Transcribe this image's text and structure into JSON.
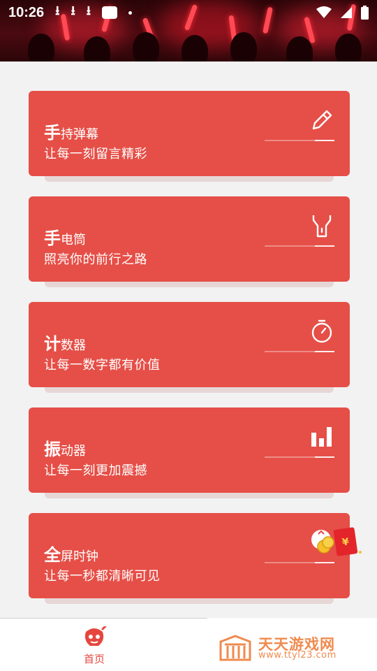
{
  "status_bar": {
    "time": "10:26"
  },
  "cards": [
    {
      "title_big": "手",
      "title_rest": "持弹幕",
      "subtitle": "让每一刻留言精彩",
      "icon": "pencil-icon"
    },
    {
      "title_big": "手",
      "title_rest": "电筒",
      "subtitle": "照亮你的前行之路",
      "icon": "flashlight-icon"
    },
    {
      "title_big": "计",
      "title_rest": "数器",
      "subtitle": "让每一数字都有价值",
      "icon": "stopwatch-icon"
    },
    {
      "title_big": "振",
      "title_rest": "动器",
      "subtitle": "让每一刻更加震撼",
      "icon": "bar-chart-icon"
    },
    {
      "title_big": "全",
      "title_rest": "屏时钟",
      "subtitle": "让每一秒都清晰可见",
      "icon": "red-envelope-icon"
    }
  ],
  "bottom_nav": {
    "home_label": "首页"
  },
  "watermark": {
    "title": "天天游戏网",
    "url": "www.ttyl23.com"
  },
  "colors": {
    "card": "#e54f47",
    "accent": "#e5473f",
    "background": "#f2f2f2"
  }
}
